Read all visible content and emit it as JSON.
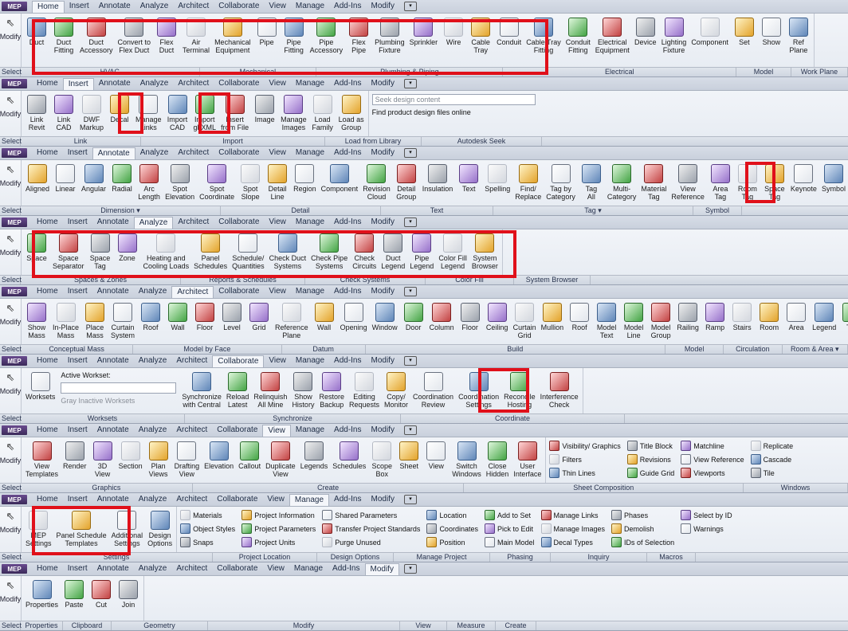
{
  "tabs": [
    "Home",
    "Insert",
    "Annotate",
    "Analyze",
    "Architect",
    "Collaborate",
    "View",
    "Manage",
    "Add-Ins",
    "Modify"
  ],
  "app_logo": "MEP",
  "left": {
    "select_label": "Select",
    "modify_label": "Modify"
  },
  "ribbons": [
    {
      "active_tab": 0,
      "tools": [
        {
          "label": "Duct",
          "icon": "duct-icon"
        },
        {
          "label": "Duct\nFitting",
          "icon": "duct-fitting-icon"
        },
        {
          "label": "Duct\nAccessory",
          "icon": "duct-accessory-icon"
        },
        {
          "label": "Convert to\nFlex Duct",
          "icon": "convert-flex-duct-icon"
        },
        {
          "label": "Flex\nDuct",
          "icon": "flex-duct-icon"
        },
        {
          "label": "Air\nTerminal",
          "icon": "air-terminal-icon"
        },
        {
          "label": "Mechanical\nEquipment",
          "icon": "mechanical-equipment-icon"
        },
        {
          "label": "Pipe",
          "icon": "pipe-icon"
        },
        {
          "label": "Pipe\nFitting",
          "icon": "pipe-fitting-icon"
        },
        {
          "label": "Pipe\nAccessory",
          "icon": "pipe-accessory-icon"
        },
        {
          "label": "Flex\nPipe",
          "icon": "flex-pipe-icon"
        },
        {
          "label": "Plumbing\nFixture",
          "icon": "plumbing-fixture-icon"
        },
        {
          "label": "Sprinkler",
          "icon": "sprinkler-icon"
        },
        {
          "label": "Wire",
          "icon": "wire-icon"
        },
        {
          "label": "Cable\nTray",
          "icon": "cable-tray-icon"
        },
        {
          "label": "Conduit",
          "icon": "conduit-icon"
        },
        {
          "label": "Cable Tray\nFitting",
          "icon": "cable-tray-fitting-icon"
        },
        {
          "label": "Conduit\nFitting",
          "icon": "conduit-fitting-icon"
        },
        {
          "label": "Electrical\nEquipment",
          "icon": "electrical-equipment-icon"
        },
        {
          "label": "Device",
          "icon": "device-icon"
        },
        {
          "label": "Lighting\nFixture",
          "icon": "lighting-fixture-icon"
        },
        {
          "label": "Component",
          "icon": "component-icon"
        },
        {
          "label": "Set",
          "icon": "set-workplane-icon"
        },
        {
          "label": "Show",
          "icon": "show-workplane-icon"
        },
        {
          "label": "Ref\nPlane",
          "icon": "ref-plane-icon"
        }
      ],
      "footer": [
        "HVAC",
        "Mechanical",
        "Plumbing & Piping",
        "Electrical",
        "Model",
        "Work Plane"
      ]
    },
    {
      "active_tab": 1,
      "tools": [
        {
          "label": "Link\nRevit",
          "icon": "link-revit-icon"
        },
        {
          "label": "Link\nCAD",
          "icon": "link-cad-icon"
        },
        {
          "label": "DWF\nMarkup",
          "icon": "dwf-markup-icon"
        },
        {
          "label": "Decal",
          "icon": "decal-icon"
        },
        {
          "label": "Manage\nLinks",
          "icon": "manage-links-icon"
        },
        {
          "label": "Import\nCAD",
          "icon": "import-cad-icon"
        },
        {
          "label": "Import\ngbXML",
          "icon": "import-gbxml-icon"
        },
        {
          "label": "Insert\nfrom File",
          "icon": "insert-from-file-icon"
        },
        {
          "label": "Image",
          "icon": "image-icon"
        },
        {
          "label": "Manage\nImages",
          "icon": "manage-images-icon"
        },
        {
          "label": "Load\nFamily",
          "icon": "load-family-icon"
        },
        {
          "label": "Load as\nGroup",
          "icon": "load-as-group-icon"
        }
      ],
      "seek_placeholder": "Seek design content",
      "seek_text": "Find product design files online",
      "footer": [
        "Link",
        "Import",
        "Load from Library",
        "Autodesk Seek"
      ]
    },
    {
      "active_tab": 2,
      "tools": [
        {
          "label": "Aligned",
          "icon": "aligned-dimension-icon"
        },
        {
          "label": "Linear",
          "icon": "linear-dimension-icon"
        },
        {
          "label": "Angular",
          "icon": "angular-dimension-icon"
        },
        {
          "label": "Radial",
          "icon": "radial-dimension-icon"
        },
        {
          "label": "Arc\nLength",
          "icon": "arc-length-icon"
        },
        {
          "label": "Spot\nElevation",
          "icon": "spot-elevation-icon"
        },
        {
          "label": "Spot\nCoordinate",
          "icon": "spot-coordinate-icon"
        },
        {
          "label": "Spot\nSlope",
          "icon": "spot-slope-icon"
        },
        {
          "label": "Detail\nLine",
          "icon": "detail-line-icon"
        },
        {
          "label": "Region",
          "icon": "region-icon"
        },
        {
          "label": "Component",
          "icon": "component-icon"
        },
        {
          "label": "Revision\nCloud",
          "icon": "revision-cloud-icon"
        },
        {
          "label": "Detail\nGroup",
          "icon": "detail-group-icon"
        },
        {
          "label": "Insulation",
          "icon": "insulation-icon"
        },
        {
          "label": "Text",
          "icon": "text-icon"
        },
        {
          "label": "Spelling",
          "icon": "spelling-icon"
        },
        {
          "label": "Find/\nReplace",
          "icon": "find-replace-icon"
        },
        {
          "label": "Tag by\nCategory",
          "icon": "tag-by-category-icon"
        },
        {
          "label": "Tag\nAll",
          "icon": "tag-all-icon"
        },
        {
          "label": "Multi-\nCategory",
          "icon": "multi-category-icon"
        },
        {
          "label": "Material\nTag",
          "icon": "material-tag-icon"
        },
        {
          "label": "View\nReference",
          "icon": "view-reference-icon"
        },
        {
          "label": "Area\nTag",
          "icon": "area-tag-icon"
        },
        {
          "label": "Room\nTag",
          "icon": "room-tag-icon"
        },
        {
          "label": "Space\nTag",
          "icon": "space-tag-icon"
        },
        {
          "label": "Keynote",
          "icon": "keynote-icon"
        },
        {
          "label": "Symbol",
          "icon": "symbol-icon"
        }
      ],
      "footer": [
        "Dimension ▾",
        "Detail",
        "Text",
        "Tag ▾",
        "Symbol"
      ]
    },
    {
      "active_tab": 3,
      "tools": [
        {
          "label": "Space",
          "icon": "space-icon"
        },
        {
          "label": "Space\nSeparator",
          "icon": "space-separator-icon"
        },
        {
          "label": "Space\nTag",
          "icon": "space-tag-icon"
        },
        {
          "label": "Zone",
          "icon": "zone-icon"
        },
        {
          "label": "Heating and\nCooling Loads",
          "icon": "heating-cooling-loads-icon"
        },
        {
          "label": "Panel\nSchedules",
          "icon": "panel-schedules-icon"
        },
        {
          "label": "Schedule/\nQuantities",
          "icon": "schedule-quantities-icon"
        },
        {
          "label": "Check Duct\nSystems",
          "icon": "check-duct-systems-icon"
        },
        {
          "label": "Check Pipe\nSystems",
          "icon": "check-pipe-systems-icon"
        },
        {
          "label": "Check\nCircuits",
          "icon": "check-circuits-icon"
        },
        {
          "label": "Duct\nLegend",
          "icon": "duct-legend-icon"
        },
        {
          "label": "Pipe\nLegend",
          "icon": "pipe-legend-icon"
        },
        {
          "label": "Color Fill\nLegend",
          "icon": "color-fill-legend-icon"
        },
        {
          "label": "System\nBrowser",
          "icon": "system-browser-icon"
        }
      ],
      "footer": [
        "Spaces & Zones",
        "Reports & Schedules",
        "Check Systems",
        "Color Fill",
        "System Browser"
      ]
    },
    {
      "active_tab": 4,
      "tools": [
        {
          "label": "Show\nMass",
          "icon": "show-mass-icon"
        },
        {
          "label": "In-Place\nMass",
          "icon": "in-place-mass-icon"
        },
        {
          "label": "Place\nMass",
          "icon": "place-mass-icon"
        },
        {
          "label": "Curtain\nSystem",
          "icon": "curtain-system-icon"
        },
        {
          "label": "Roof",
          "icon": "roof-icon"
        },
        {
          "label": "Wall",
          "icon": "wall-icon"
        },
        {
          "label": "Floor",
          "icon": "floor-icon"
        },
        {
          "label": "Level",
          "icon": "level-icon"
        },
        {
          "label": "Grid",
          "icon": "grid-icon"
        },
        {
          "label": "Reference\nPlane",
          "icon": "reference-plane-icon"
        },
        {
          "label": "Wall",
          "icon": "wall-icon"
        },
        {
          "label": "Opening",
          "icon": "opening-icon"
        },
        {
          "label": "Window",
          "icon": "window-icon"
        },
        {
          "label": "Door",
          "icon": "door-icon"
        },
        {
          "label": "Column",
          "icon": "column-icon"
        },
        {
          "label": "Floor",
          "icon": "floor-icon"
        },
        {
          "label": "Ceiling",
          "icon": "ceiling-icon"
        },
        {
          "label": "Curtain\nGrid",
          "icon": "curtain-grid-icon"
        },
        {
          "label": "Mullion",
          "icon": "mullion-icon"
        },
        {
          "label": "Roof",
          "icon": "roof-icon"
        },
        {
          "label": "Model\nText",
          "icon": "model-text-icon"
        },
        {
          "label": "Model\nLine",
          "icon": "model-line-icon"
        },
        {
          "label": "Model\nGroup",
          "icon": "model-group-icon"
        },
        {
          "label": "Railing",
          "icon": "railing-icon"
        },
        {
          "label": "Ramp",
          "icon": "ramp-icon"
        },
        {
          "label": "Stairs",
          "icon": "stairs-icon"
        },
        {
          "label": "Room",
          "icon": "room-icon"
        },
        {
          "label": "Area",
          "icon": "area-icon"
        },
        {
          "label": "Legend",
          "icon": "legend-icon"
        },
        {
          "label": "Tag",
          "icon": "tag-icon"
        }
      ],
      "footer": [
        "Conceptual Mass",
        "Model by Face",
        "Datum",
        "Build",
        "Model",
        "Circulation",
        "Room & Area ▾"
      ]
    },
    {
      "active_tab": 5,
      "tools": [
        {
          "label": "Worksets",
          "icon": "worksets-icon"
        },
        {
          "label": "Synchronize\nwith Central",
          "icon": "synchronize-icon"
        },
        {
          "label": "Reload\nLatest",
          "icon": "reload-latest-icon"
        },
        {
          "label": "Relinquish\nAll Mine",
          "icon": "relinquish-icon"
        },
        {
          "label": "Show\nHistory",
          "icon": "show-history-icon"
        },
        {
          "label": "Restore\nBackup",
          "icon": "restore-backup-icon"
        },
        {
          "label": "Editing\nRequests",
          "icon": "editing-requests-icon"
        },
        {
          "label": "Copy/\nMonitor",
          "icon": "copy-monitor-icon"
        },
        {
          "label": "Coordination\nReview",
          "icon": "coordination-review-icon"
        },
        {
          "label": "Coordination\nSettings",
          "icon": "coordination-settings-icon"
        },
        {
          "label": "Reconcile\nHosting",
          "icon": "reconcile-hosting-icon"
        },
        {
          "label": "Interference\nCheck",
          "icon": "interference-check-icon"
        }
      ],
      "active_workset_label": "Active Workset:",
      "gray_inactive": "Gray Inactive Worksets",
      "footer": [
        "Worksets",
        "Synchronize",
        "Coordinate"
      ]
    },
    {
      "active_tab": 6,
      "tools": [
        {
          "label": "View\nTemplates",
          "icon": "view-templates-icon"
        },
        {
          "label": "Render",
          "icon": "render-icon"
        },
        {
          "label": "3D\nView",
          "icon": "3d-view-icon"
        },
        {
          "label": "Section",
          "icon": "section-icon"
        },
        {
          "label": "Plan\nViews",
          "icon": "plan-views-icon"
        },
        {
          "label": "Drafting\nView",
          "icon": "drafting-view-icon"
        },
        {
          "label": "Elevation",
          "icon": "elevation-icon"
        },
        {
          "label": "Callout",
          "icon": "callout-icon"
        },
        {
          "label": "Duplicate\nView",
          "icon": "duplicate-view-icon"
        },
        {
          "label": "Legends",
          "icon": "legends-icon"
        },
        {
          "label": "Schedules",
          "icon": "schedules-icon"
        },
        {
          "label": "Scope\nBox",
          "icon": "scope-box-icon"
        },
        {
          "label": "Sheet",
          "icon": "sheet-icon"
        },
        {
          "label": "View",
          "icon": "view-icon"
        },
        {
          "label": "Switch\nWindows",
          "icon": "switch-windows-icon"
        },
        {
          "label": "Close\nHidden",
          "icon": "close-hidden-icon"
        },
        {
          "label": "User\nInterface",
          "icon": "user-interface-icon"
        }
      ],
      "small": [
        "Visibility/ Graphics",
        "Filters",
        "Thin Lines",
        "Title Block",
        "Revisions",
        "Guide Grid",
        "Matchline",
        "View Reference",
        "Viewports",
        "Replicate",
        "Cascade",
        "Tile"
      ],
      "footer": [
        "Graphics",
        "Create",
        "Sheet Composition",
        "Windows"
      ]
    },
    {
      "active_tab": 7,
      "tools": [
        {
          "label": "MEP\nSettings",
          "icon": "mep-settings-icon"
        },
        {
          "label": "Panel Schedule\nTemplates",
          "icon": "panel-schedule-templates-icon"
        },
        {
          "label": "Additional\nSettings",
          "icon": "additional-settings-icon"
        },
        {
          "label": "Design\nOptions",
          "icon": "design-options-icon"
        }
      ],
      "small": [
        "Materials",
        "Object Styles",
        "Snaps",
        "Project Information",
        "Project Parameters",
        "Project Units",
        "Shared Parameters",
        "Transfer Project Standards",
        "Purge Unused",
        "Location",
        "Coordinates",
        "Position",
        "Add to Set",
        "Pick to Edit",
        "Main Model",
        "Manage Links",
        "Manage Images",
        "Decal Types",
        "Phases",
        "Demolish",
        "IDs of Selection",
        "Select by ID",
        "Warnings"
      ],
      "footer": [
        "Settings",
        "Project Location",
        "Design Options",
        "Manage Project",
        "Phasing",
        "Inquiry",
        "Macros"
      ]
    },
    {
      "active_tab": 9,
      "tools": [
        {
          "label": "Properties",
          "icon": "properties-icon"
        },
        {
          "label": "Paste",
          "icon": "paste-icon"
        },
        {
          "label": "Cut",
          "icon": "cut-icon"
        },
        {
          "label": "Join",
          "icon": "join-icon"
        }
      ],
      "footer": [
        "Properties",
        "Clipboard",
        "Geometry",
        "Modify",
        "View",
        "Measure",
        "Create"
      ]
    }
  ]
}
